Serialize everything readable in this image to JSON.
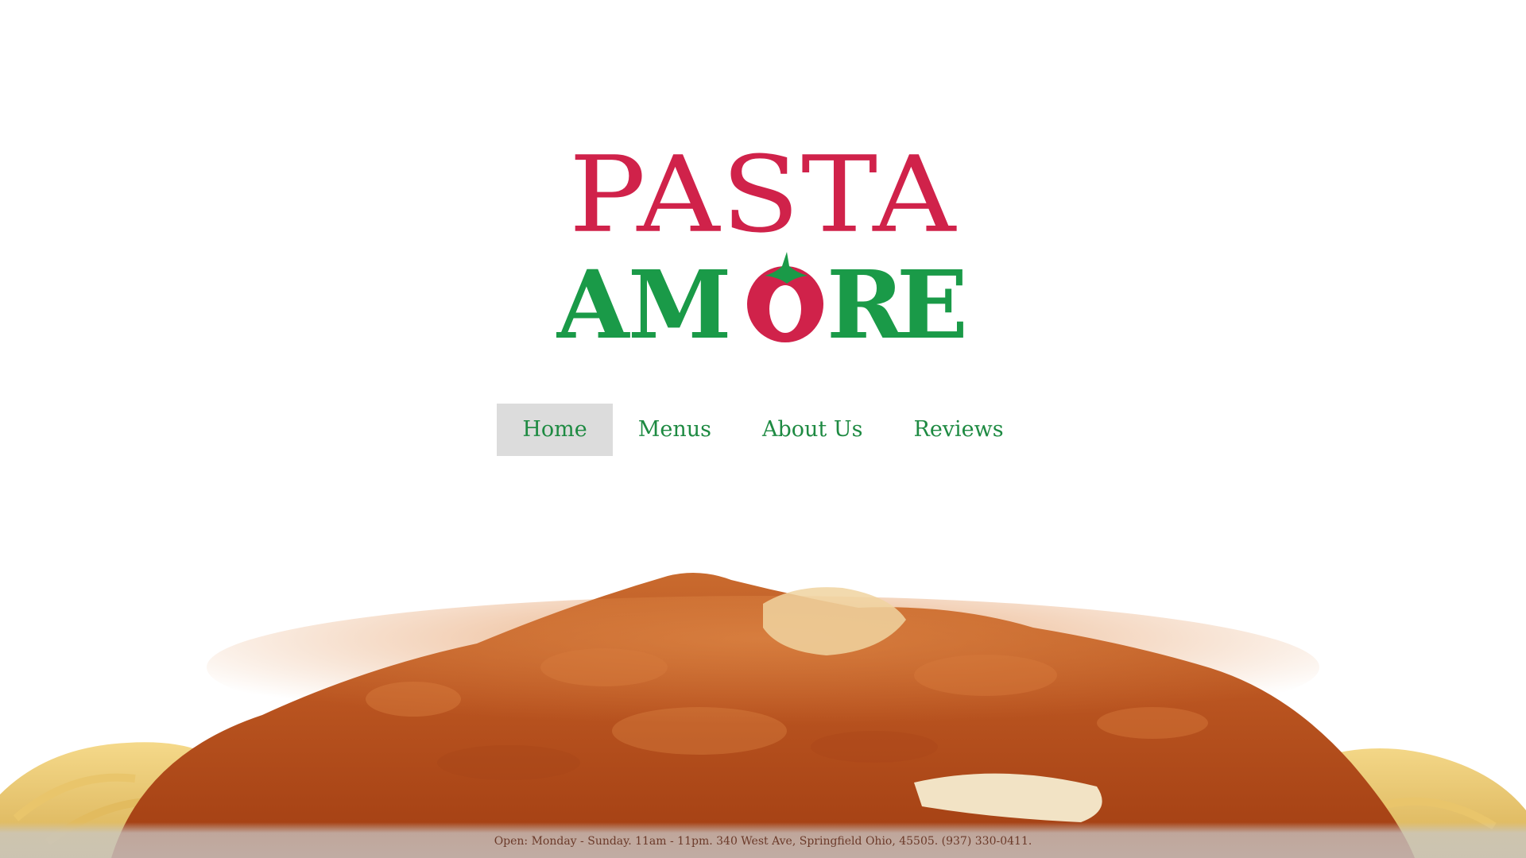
{
  "logo": {
    "top_text": "PASTA",
    "bottom_text": "AMORE",
    "colors": {
      "red": "#d0224a",
      "green": "#1a9a48"
    }
  },
  "nav": {
    "items": [
      {
        "label": "Home",
        "active": true
      },
      {
        "label": "Menus",
        "active": false
      },
      {
        "label": "About Us",
        "active": false
      },
      {
        "label": "Reviews",
        "active": false
      }
    ],
    "active_background": "#dcdcdc",
    "text_color": "#1e8a42"
  },
  "hero": {
    "image": "pasta-with-tomato-sauce"
  },
  "footer": {
    "text": "Open: Monday - Sunday. 11am - 11pm. 340 West Ave, Springfield Ohio, 45505. (937) 330-0411."
  }
}
